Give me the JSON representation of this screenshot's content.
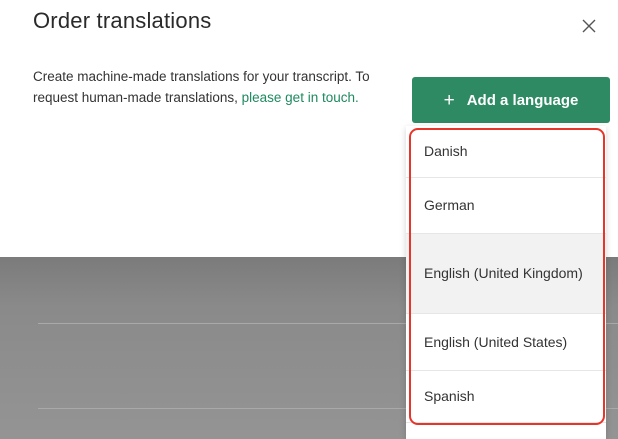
{
  "modal": {
    "title": "Order translations",
    "description": "Create machine-made translations for your transcript. To request human-made translations,",
    "contact_link": "please get in touch.",
    "add_language_button": "Add a language",
    "close_icon": "close-icon",
    "plus_icon": "plus-icon"
  },
  "dropdown": {
    "items": [
      {
        "label": "Danish"
      },
      {
        "label": "German"
      },
      {
        "label": "English (United Kingdom)"
      },
      {
        "label": "English (United States)"
      },
      {
        "label": "Spanish"
      }
    ]
  },
  "colors": {
    "accent": "#2e8a63",
    "link": "#1d8a5f",
    "highlight": "#e8352a"
  }
}
